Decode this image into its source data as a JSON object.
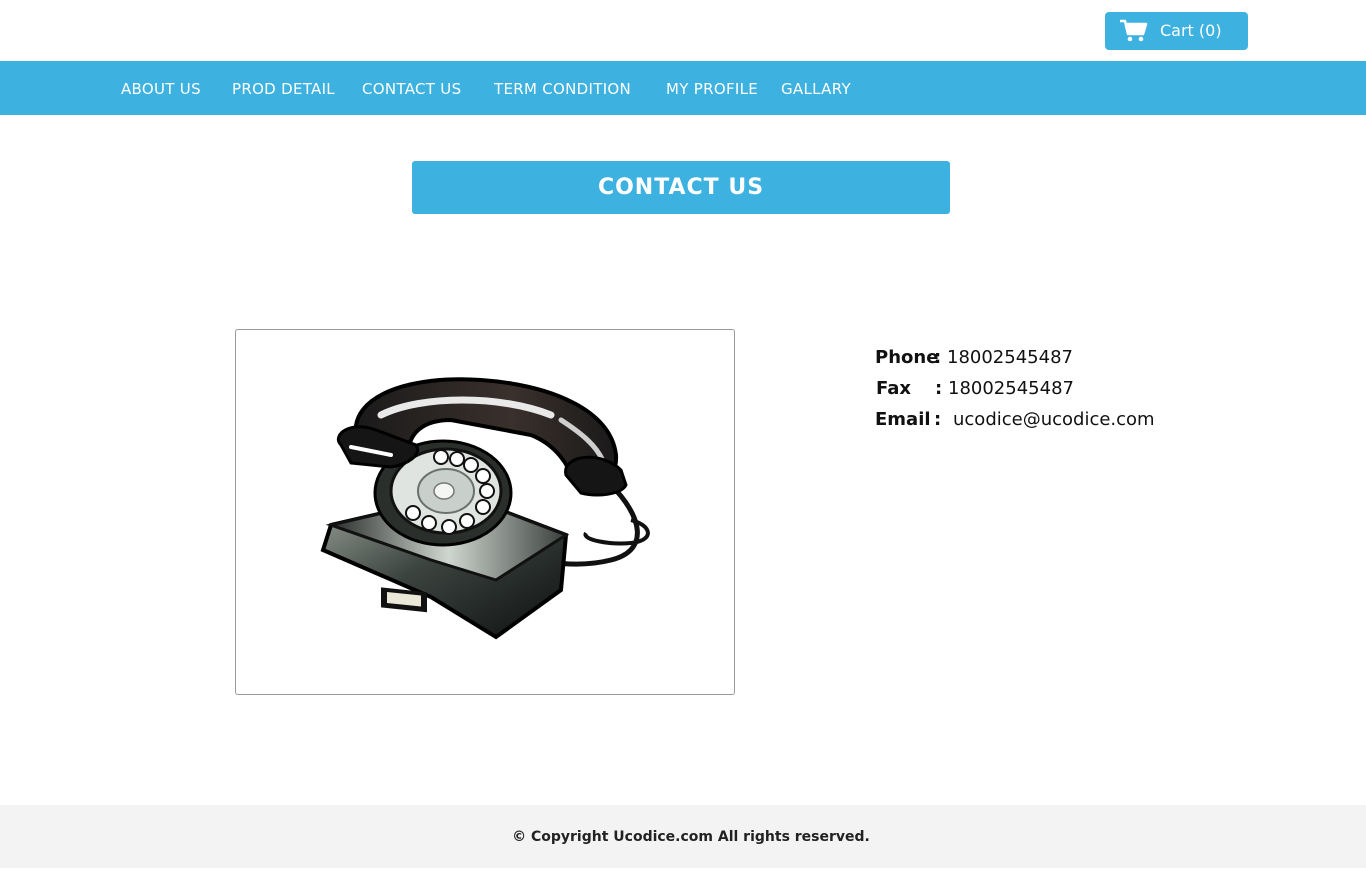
{
  "header": {
    "cart_label": "Cart (0)",
    "cart_icon": "shopping-cart-icon"
  },
  "nav": {
    "items": [
      {
        "label": "ABOUT US"
      },
      {
        "label": "PROD DETAIL"
      },
      {
        "label": "CONTACT US"
      },
      {
        "label": "TERM CONDITION"
      },
      {
        "label": "MY PROFILE"
      },
      {
        "label": "GALLARY"
      }
    ]
  },
  "main": {
    "title": "CONTACT US",
    "image_icon": "rotary-telephone-icon",
    "contact": {
      "phone_label": "Phone",
      "phone_value": "18002545487",
      "fax_label": "Fax",
      "fax_value": "18002545487",
      "email_label": "Email",
      "email_value": "ucodice@ucodice.com",
      "separator": ":"
    }
  },
  "footer": {
    "copyright": "© Copyright Ucodice.com All rights reserved."
  },
  "colors": {
    "accent": "#3db1e0",
    "footer_bg": "#f3f3f3",
    "text": "#111111"
  }
}
